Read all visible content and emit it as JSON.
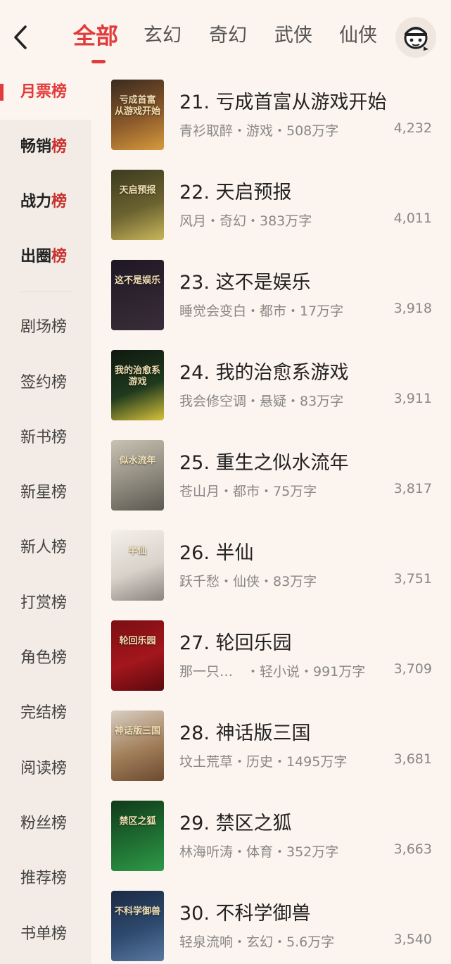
{
  "tabs": [
    "全部",
    "玄幻",
    "奇幻",
    "武侠",
    "仙侠"
  ],
  "sidebar": {
    "primary": [
      {
        "pre": "月票",
        "acc": "榜"
      },
      {
        "pre": "畅销",
        "acc": "榜"
      },
      {
        "pre": "战力",
        "acc": "榜"
      },
      {
        "pre": "出圈",
        "acc": "榜"
      }
    ],
    "secondary": [
      "剧场榜",
      "签约榜",
      "新书榜",
      "新星榜",
      "新人榜",
      "打赏榜",
      "角色榜",
      "完结榜",
      "阅读榜",
      "粉丝榜",
      "推荐榜",
      "书单榜"
    ]
  },
  "books": [
    {
      "title": "21. 亏成首富从游戏开始",
      "meta": "青衫取醉・游戏・508万字",
      "score": "4,232",
      "cover_text": "亏成首富 从游戏开始",
      "cover_colors": [
        "#3a2a1e",
        "#8b5a2b",
        "#d69a3c"
      ]
    },
    {
      "title": "22. 天启预报",
      "meta": "风月・奇幻・383万字",
      "score": "4,011",
      "cover_text": "天启预报",
      "cover_colors": [
        "#3c3a20",
        "#6b6230",
        "#c9b65a"
      ]
    },
    {
      "title": "23. 这不是娱乐",
      "meta": "睡觉会变白・都市・17万字",
      "score": "3,918",
      "cover_text": "这不是娱乐",
      "cover_colors": [
        "#1e1824",
        "#2e2430",
        "#3a2c3a"
      ]
    },
    {
      "title": "24. 我的治愈系游戏",
      "meta": "我会修空调・悬疑・83万字",
      "score": "3,911",
      "cover_text": "我的治愈系游戏",
      "cover_colors": [
        "#101810",
        "#1f3a1e",
        "#d8c23a"
      ]
    },
    {
      "title": "25. 重生之似水流年",
      "meta": "苍山月・都市・75万字",
      "score": "3,817",
      "cover_text": "似水流年",
      "cover_colors": [
        "#c8c2b2",
        "#8e8a7e",
        "#5a5850"
      ]
    },
    {
      "title": "26. 半仙",
      "meta": "跃千愁・仙侠・83万字",
      "score": "3,751",
      "cover_text": "半仙",
      "cover_colors": [
        "#f4f0ea",
        "#d8d2ca",
        "#8a8480"
      ]
    },
    {
      "title": "27. 轮回乐园",
      "meta": "那一只…　・轻小说・991万字",
      "score": "3,709",
      "cover_text": "轮回乐园",
      "cover_colors": [
        "#7a0f14",
        "#a3161c",
        "#5a0a0e"
      ]
    },
    {
      "title": "28. 神话版三国",
      "meta": "坟土荒草・历史・1495万字",
      "score": "3,681",
      "cover_text": "神话版三国",
      "cover_colors": [
        "#d8cfc2",
        "#a27e5a",
        "#6b4a30"
      ]
    },
    {
      "title": "29. 禁区之狐",
      "meta": "林海听涛・体育・352万字",
      "score": "3,663",
      "cover_text": "禁区之狐",
      "cover_colors": [
        "#0f3a1a",
        "#1f6e32",
        "#2e9a48"
      ]
    },
    {
      "title": "30. 不科学御兽",
      "meta": "轻泉流响・玄幻・5.6万字",
      "score": "3,540",
      "cover_text": "不科学御兽",
      "cover_colors": [
        "#1a2a44",
        "#2e4a6e",
        "#5a78a0"
      ]
    }
  ]
}
